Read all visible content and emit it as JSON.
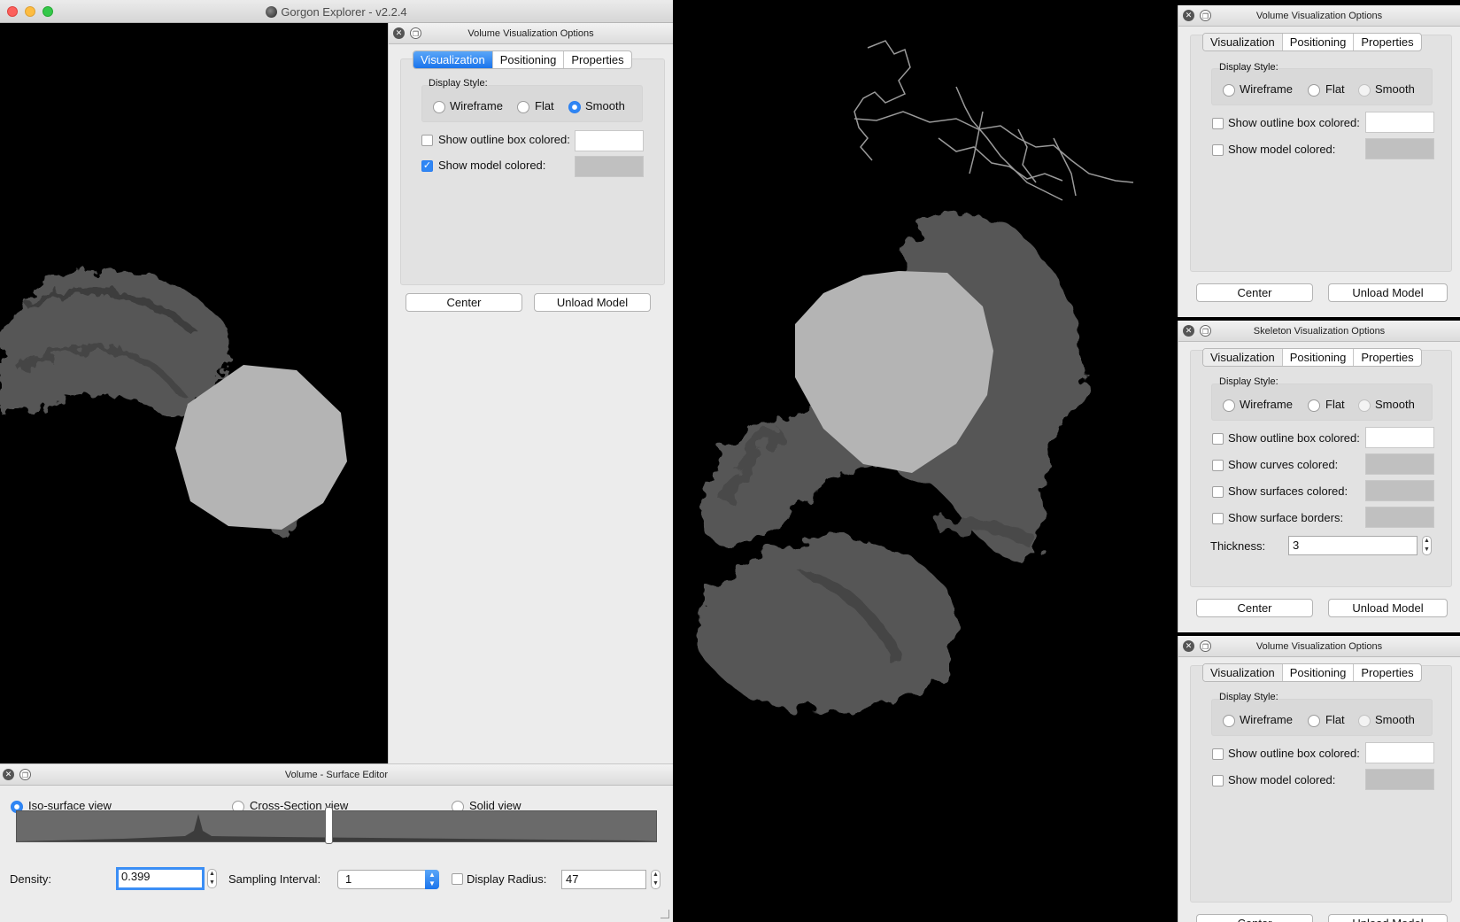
{
  "app": {
    "title": "Gorgon Explorer - v2.2.4"
  },
  "volume_panel_left": {
    "title": "Volume Visualization Options",
    "tabs": [
      "Visualization",
      "Positioning",
      "Properties"
    ],
    "display_style_label": "Display Style:",
    "styles": [
      "Wireframe",
      "Flat",
      "Smooth"
    ],
    "selected_style": "Smooth",
    "show_outline_label": "Show outline box colored:",
    "show_outline_checked": false,
    "show_model_label": "Show model colored:",
    "show_model_checked": true,
    "center_label": "Center",
    "unload_label": "Unload Model"
  },
  "surface_editor": {
    "title": "Volume - Surface Editor",
    "views": [
      "Iso-surface view",
      "Cross-Section view",
      "Solid view"
    ],
    "selected_view": "Iso-surface view",
    "density_label": "Density:",
    "density_value": "0.399",
    "sampling_label": "Sampling Interval:",
    "sampling_value": "1",
    "display_radius_label": "Display Radius:",
    "display_radius_checked": false,
    "display_radius_value": "47"
  },
  "right_panel_volume_1": {
    "title": "Volume Visualization Options",
    "tabs": [
      "Visualization",
      "Positioning",
      "Properties"
    ],
    "display_style_label": "Display Style:",
    "styles": [
      "Wireframe",
      "Flat",
      "Smooth"
    ],
    "show_outline_label": "Show outline box colored:",
    "show_model_label": "Show model colored:",
    "center_label": "Center",
    "unload_label": "Unload Model"
  },
  "right_panel_skeleton": {
    "title": "Skeleton Visualization Options",
    "tabs": [
      "Visualization",
      "Positioning",
      "Properties"
    ],
    "display_style_label": "Display Style:",
    "styles": [
      "Wireframe",
      "Flat",
      "Smooth"
    ],
    "show_outline_label": "Show outline box colored:",
    "show_curves_label": "Show curves colored:",
    "show_surfaces_label": "Show surfaces colored:",
    "show_borders_label": "Show surface borders:",
    "thickness_label": "Thickness:",
    "thickness_value": "3",
    "center_label": "Center",
    "unload_label": "Unload Model"
  },
  "right_panel_volume_2": {
    "title": "Volume Visualization Options",
    "tabs": [
      "Visualization",
      "Positioning",
      "Properties"
    ],
    "display_style_label": "Display Style:",
    "styles": [
      "Wireframe",
      "Flat",
      "Smooth"
    ],
    "show_outline_label": "Show outline box colored:",
    "show_model_label": "Show model colored:",
    "center_label": "Center",
    "unload_label": "Unload Model"
  },
  "colors": {
    "accent": "#2f86f4",
    "surface_grey": "#595959",
    "sphere_grey": "#b4b4b4",
    "panel_bg": "#ececec"
  }
}
